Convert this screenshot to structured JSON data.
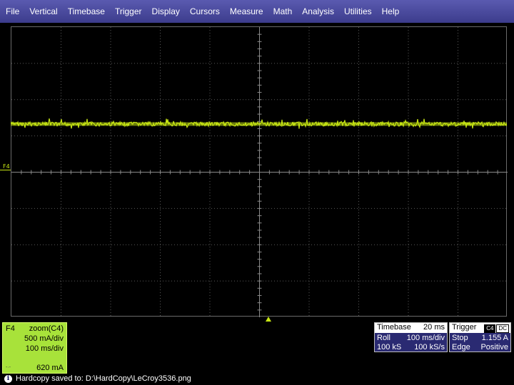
{
  "menu": [
    "File",
    "Vertical",
    "Timebase",
    "Trigger",
    "Display",
    "Cursors",
    "Measure",
    "Math",
    "Analysis",
    "Utilities",
    "Help"
  ],
  "channel": {
    "label": "F4",
    "source": "zoom(C4)",
    "vdiv": "500 mA/div",
    "hdiv": "100 ms/div",
    "offset": "620 mA",
    "color": "#a8e23a"
  },
  "marker_label": "F4",
  "timebase": {
    "title": "Timebase",
    "value": "20 ms",
    "mode": "Roll",
    "hdiv": "100 ms/div",
    "samples": "100 kS",
    "rate": "100 kS/s"
  },
  "trigger": {
    "title": "Trigger",
    "channel": "C4",
    "coupling": "DC",
    "mode": "Stop",
    "level": "1.155 A",
    "type": "Edge",
    "slope": "Positive"
  },
  "status": {
    "icon": "info-icon",
    "text": "Hardcopy saved to: D:\\HardCopy\\LeCroy3536.png"
  },
  "colors": {
    "trace": "#c7e614",
    "menu_bg": "#4a4aa0",
    "info_bg": "#2a2a72"
  }
}
